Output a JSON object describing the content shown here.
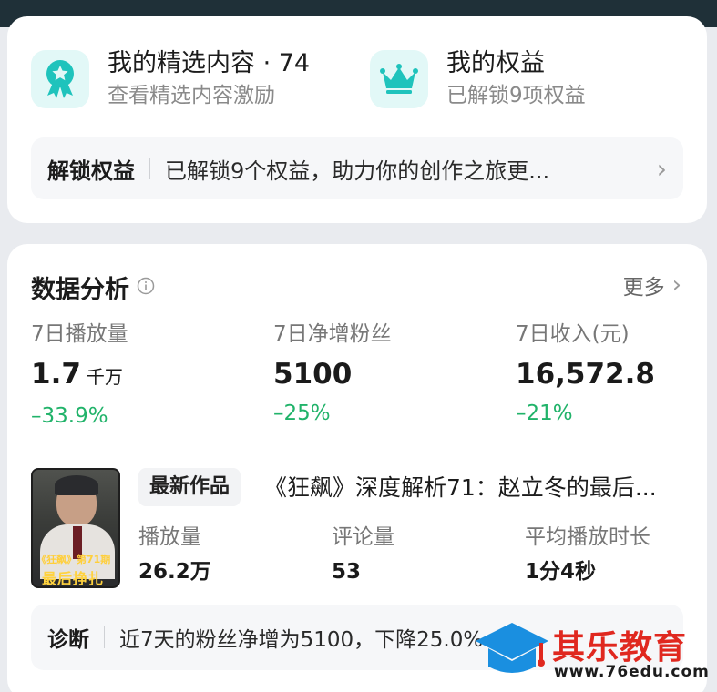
{
  "featured": {
    "title": "我的精选内容 · 74",
    "subtitle": "查看精选内容激励",
    "icon": "ribbon-badge-icon"
  },
  "benefits": {
    "title": "我的权益",
    "subtitle": "已解锁9项权益",
    "icon": "crown-icon"
  },
  "unlock": {
    "label": "解锁权益",
    "text": "已解锁9个权益，助力你的创作之旅更..."
  },
  "analytics": {
    "title": "数据分析",
    "more": "更多",
    "stats": [
      {
        "label": "7日播放量",
        "value": "1.7",
        "unit": "千万",
        "change": "–33.9%"
      },
      {
        "label": "7日净增粉丝",
        "value": "5100",
        "unit": "",
        "change": "–25%"
      },
      {
        "label": "7日收入(元)",
        "value": "16,572.8",
        "unit": "",
        "change": "–21%"
      }
    ]
  },
  "latest": {
    "badge": "最新作品",
    "title": "《狂飙》深度解析71：赵立冬的最后...",
    "thumb_caption_top": "《狂飙》第71期",
    "thumb_caption_bottom": "最后挣扎",
    "stats": [
      {
        "label": "播放量",
        "value": "26.2万"
      },
      {
        "label": "评论量",
        "value": "53"
      },
      {
        "label": "平均播放时长",
        "value": "1分4秒"
      }
    ]
  },
  "diagnosis": {
    "label": "诊断",
    "text": "近7天的粉丝净增为5100，下降25.0%"
  },
  "watermark_logo": {
    "name": "其乐教育",
    "url": "www.76edu.com"
  },
  "colors": {
    "accent": "#1fc3bc",
    "decrease": "#21b36a",
    "logo_red": "#e0281f",
    "logo_blue": "#1a8fe0"
  }
}
